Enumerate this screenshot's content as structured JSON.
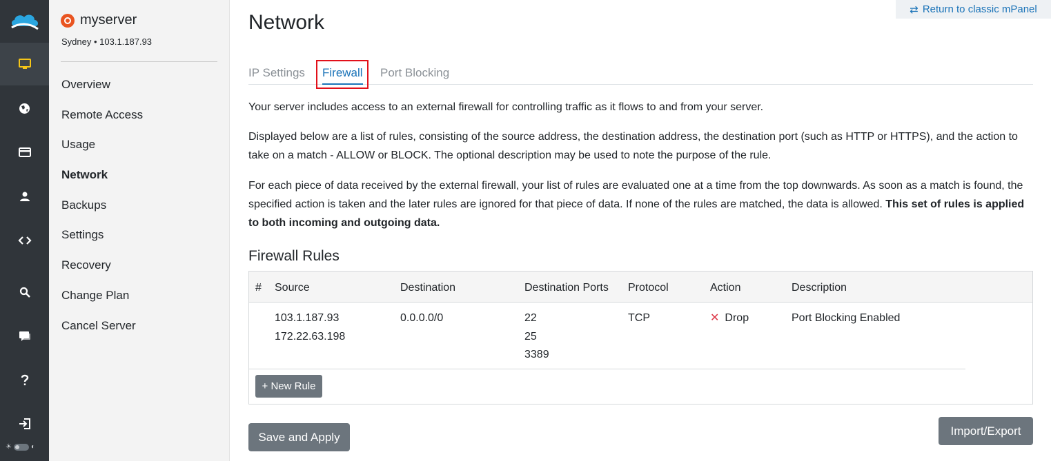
{
  "rail": {
    "logo_icon": "cloud-logo-icon",
    "items": [
      {
        "icon": "monitor-icon",
        "active": true
      },
      {
        "icon": "globe-icon",
        "active": false
      },
      {
        "icon": "credit-card-icon",
        "active": false
      },
      {
        "icon": "user-icon",
        "active": false
      },
      {
        "icon": "code-icon",
        "active": false
      },
      {
        "icon": "search-icon",
        "active": false
      },
      {
        "icon": "chat-icon",
        "active": false
      },
      {
        "icon": "help-icon",
        "active": false
      },
      {
        "icon": "logout-icon",
        "active": false
      }
    ],
    "theme_toggle_icons": [
      "sun-icon",
      "moon-icon"
    ]
  },
  "server": {
    "name": "myserver",
    "location": "Sydney • 103.1.187.93",
    "os_icon": "ubuntu-icon"
  },
  "subnav": {
    "items": [
      {
        "label": "Overview"
      },
      {
        "label": "Remote Access"
      },
      {
        "label": "Usage"
      },
      {
        "label": "Network"
      },
      {
        "label": "Backups"
      },
      {
        "label": "Settings"
      },
      {
        "label": "Recovery"
      },
      {
        "label": "Change Plan"
      },
      {
        "label": "Cancel Server"
      }
    ],
    "active": "Network"
  },
  "header": {
    "classic_link": "Return to classic mPanel",
    "title": "Network"
  },
  "tabs": [
    {
      "label": "IP Settings"
    },
    {
      "label": "Firewall"
    },
    {
      "label": "Port Blocking"
    }
  ],
  "active_tab": "Firewall",
  "intro": {
    "p1": "Your server includes access to an external firewall for controlling traffic as it flows to and from your server.",
    "p2": "Displayed below are a list of rules, consisting of the source address, the destination address, the destination port (such as HTTP or HTTPS), and the action to take on a match - ALLOW or BLOCK. The optional description may be used to note the purpose of the rule.",
    "p3_text": "For each piece of data received by the external firewall, your list of rules are evaluated one at a time from the top downwards. As soon as a match is found, the specified action is taken and the later rules are ignored for that piece of data. If none of the rules are matched, the data is allowed.",
    "p3_bold": "This set of rules is applied to both incoming and outgoing data."
  },
  "firewall": {
    "section_title": "Firewall Rules",
    "columns": {
      "num": "#",
      "source": "Source",
      "destination": "Destination",
      "ports": "Destination Ports",
      "protocol": "Protocol",
      "action": "Action",
      "description": "Description"
    },
    "rows": [
      {
        "source": [
          "103.1.187.93",
          "172.22.63.198"
        ],
        "destination": "0.0.0.0/0",
        "ports": [
          "22",
          "25",
          "3389"
        ],
        "protocol": "TCP",
        "action_mark": "✕",
        "action": "Drop",
        "description": "Port Blocking Enabled"
      }
    ],
    "new_rule_button": "+ New Rule"
  },
  "footer": {
    "save_button": "Save and Apply",
    "import_button": "Import/Export"
  },
  "colors": {
    "accent": "#1a73b8",
    "rail_bg": "#30353a",
    "active_icon": "#f5c518",
    "drop": "#dc3545",
    "button": "#6c757d"
  }
}
